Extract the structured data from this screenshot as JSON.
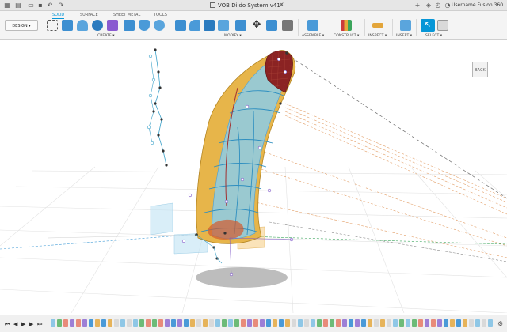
{
  "titlebar": {
    "document_title": "VOB Dildo System v41*",
    "user_name": "Username Fusion 360",
    "close_glyph": "×"
  },
  "toolbar": {
    "workspace": "DESIGN ▾",
    "tabs": [
      {
        "label": "SOLID",
        "active": true
      },
      {
        "label": "SURFACE",
        "active": false
      },
      {
        "label": "SHEET METAL",
        "active": false
      },
      {
        "label": "TOOLS",
        "active": false
      }
    ],
    "groups": {
      "create": "CREATE ▾",
      "modify": "MODIFY ▾",
      "assemble": "ASSEMBLE ▾",
      "construct": "CONSTRUCT ▾",
      "inspect": "INSPECT ▾",
      "insert": "INSERT ▾",
      "select": "SELECT ▾"
    }
  },
  "viewcube": {
    "face": "BACK"
  },
  "colors": {
    "accent": "#0696d7",
    "body_gold": "#e7b54a",
    "body_blue": "#8ccde7",
    "curve_blue": "#2f8fc0",
    "tip_red": "#8b2323",
    "guide_orange": "#e9a069",
    "guide_gray": "#777777",
    "grid": "#e4e4e4"
  },
  "timeline": {
    "controls": [
      "⏮",
      "◀",
      "▶",
      "▶",
      "⏭"
    ]
  }
}
